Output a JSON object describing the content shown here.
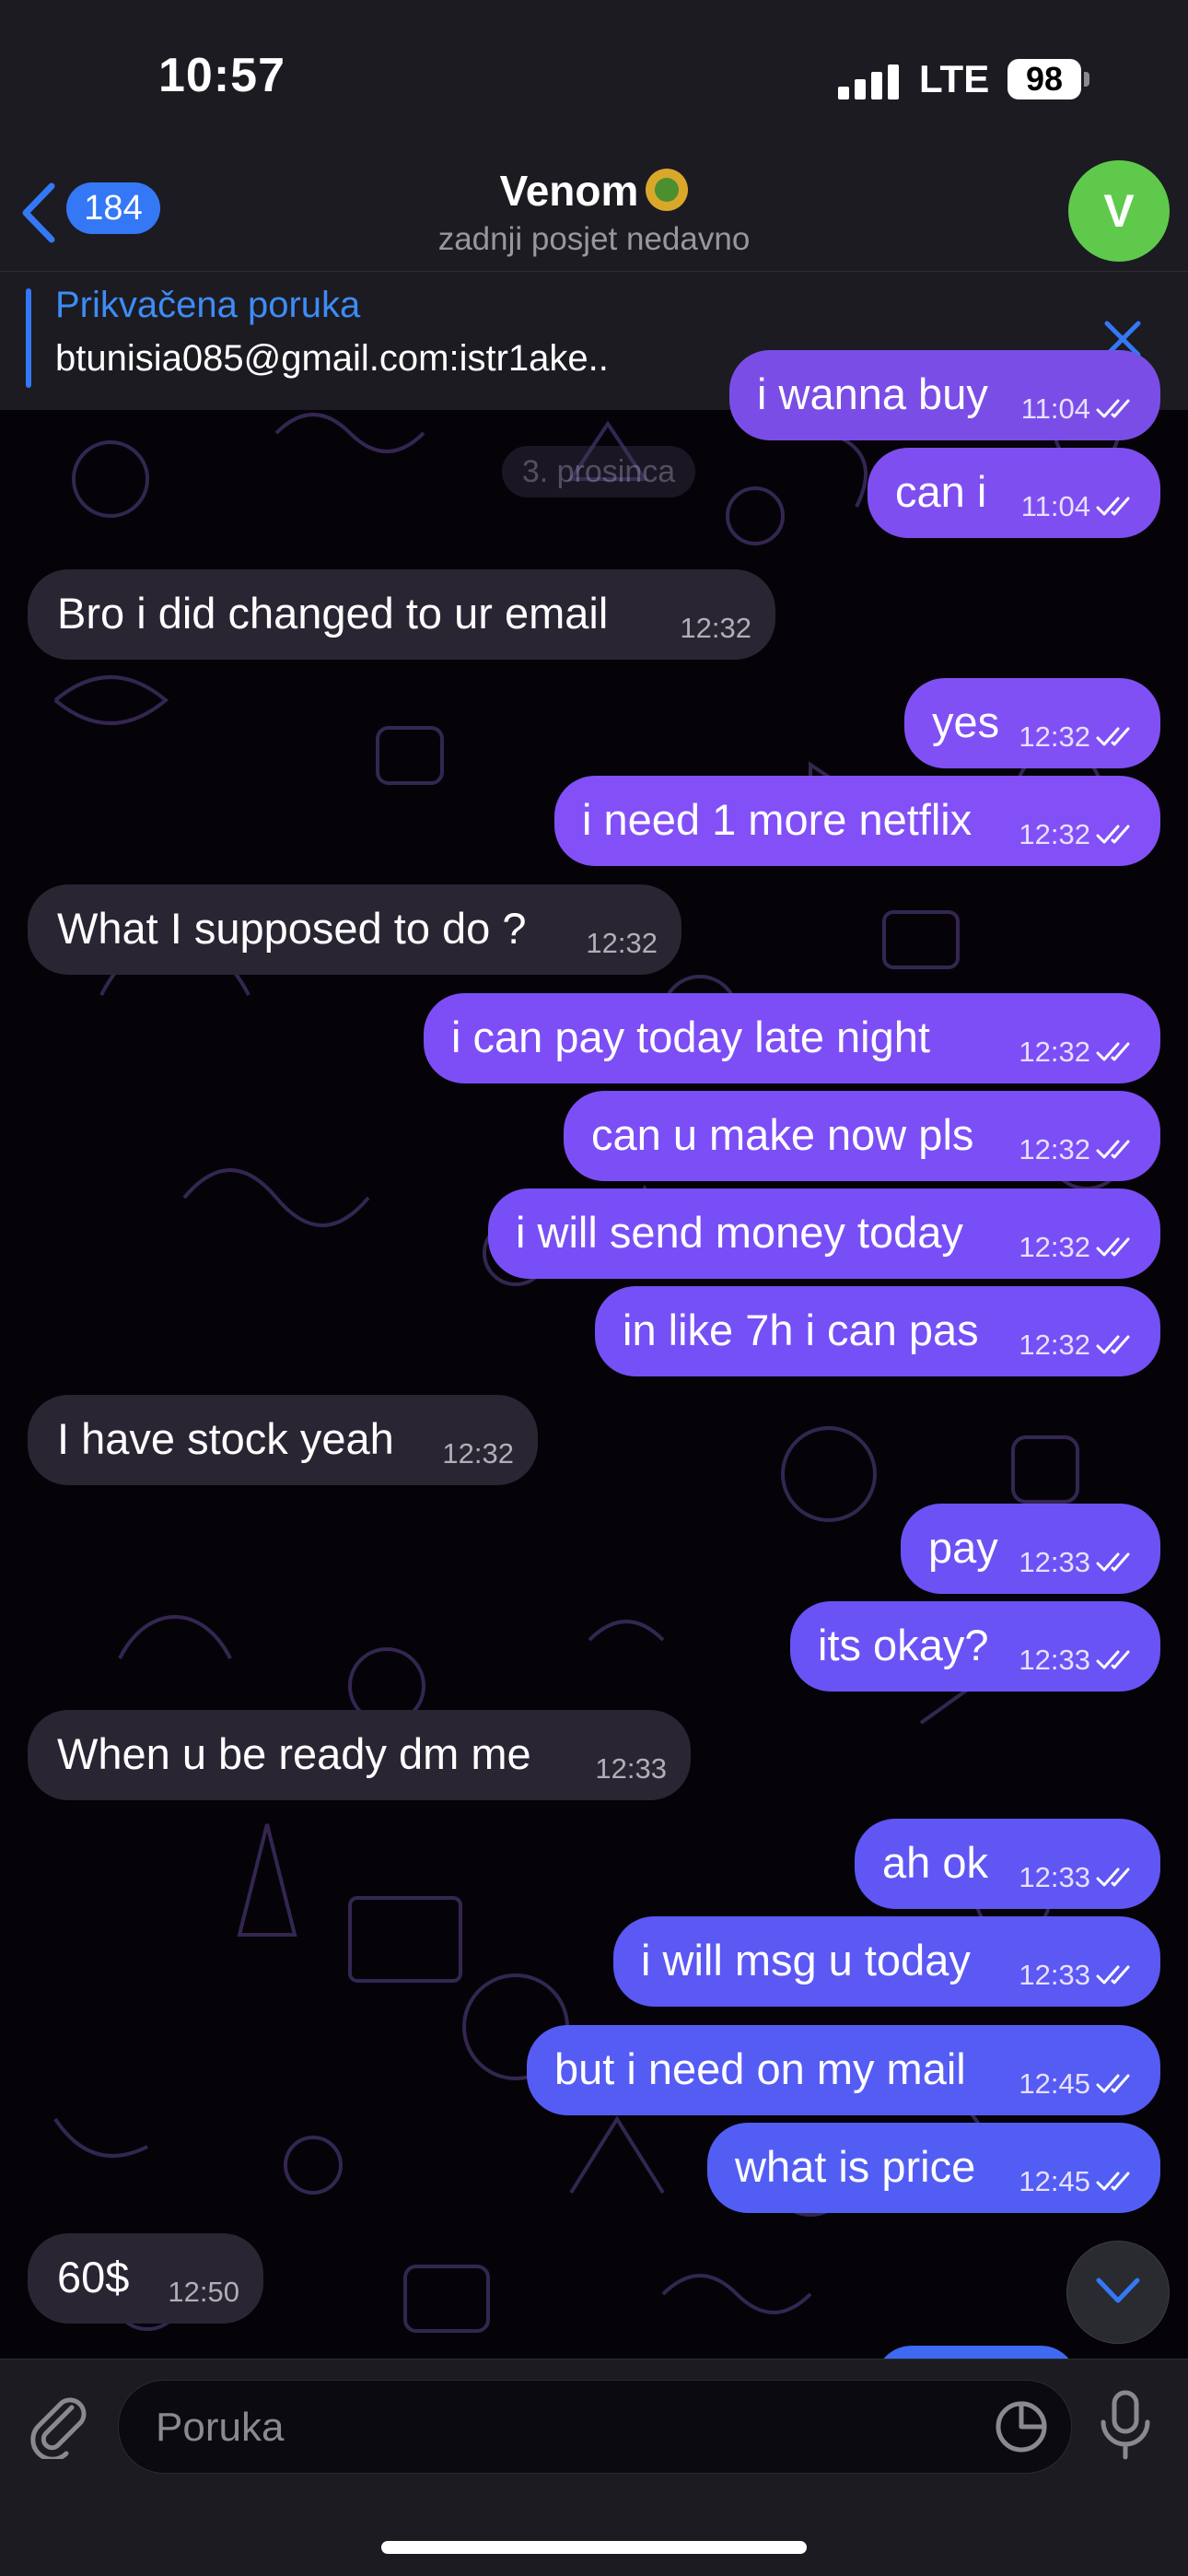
{
  "status_bar": {
    "time": "10:57",
    "network": "LTE",
    "battery": "98"
  },
  "header": {
    "back_count": "184",
    "contact_name": "Venom",
    "status": "zadnji posjet nedavno",
    "avatar_letter": "V"
  },
  "pinned": {
    "title": "Prikvačena poruka",
    "text": "btunisia085@gmail.com:istr1ake.."
  },
  "date_separator": "3. prosinca",
  "messages": [
    {
      "dir": "out",
      "text": "i wanna buy",
      "time": "11:04",
      "color": "#7a4ee6"
    },
    {
      "dir": "out",
      "text": "can i",
      "time": "11:04",
      "color": "#7f4ef0"
    },
    {
      "dir": "in",
      "text": "Bro i did changed to ur email",
      "time": "12:32"
    },
    {
      "dir": "out",
      "text": "yes",
      "time": "12:32",
      "color": "#8150f5"
    },
    {
      "dir": "out",
      "text": "i need 1 more netflix",
      "time": "12:32",
      "color": "#8250f6"
    },
    {
      "dir": "in",
      "text": "What I supposed to do ?",
      "time": "12:32"
    },
    {
      "dir": "out",
      "text": "i can pay today late night",
      "time": "12:32",
      "color": "#7d4ef6"
    },
    {
      "dir": "out",
      "text": "can u make now pls",
      "time": "12:32",
      "color": "#7b4ef6"
    },
    {
      "dir": "out",
      "text": "i will send money today",
      "time": "12:32",
      "color": "#784ff6"
    },
    {
      "dir": "out",
      "text": "in like 7h i can pas",
      "time": "12:32",
      "color": "#7450f6"
    },
    {
      "dir": "in",
      "text": "I have stock yeah",
      "time": "12:32"
    },
    {
      "dir": "out",
      "text": "pay",
      "time": "12:33",
      "color": "#6c52f5"
    },
    {
      "dir": "out",
      "text": "its okay?",
      "time": "12:33",
      "color": "#6953f5"
    },
    {
      "dir": "in",
      "text": "When u be ready dm me",
      "time": "12:33"
    },
    {
      "dir": "out",
      "text": "ah ok",
      "time": "12:33",
      "color": "#5f56f4"
    },
    {
      "dir": "out",
      "text": "i will msg u today",
      "time": "12:33",
      "color": "#5b58f4"
    },
    {
      "dir": "out",
      "text": "but i need on my mail",
      "time": "12:45",
      "color": "#555cf3"
    },
    {
      "dir": "out",
      "text": "what is price",
      "time": "12:45",
      "color": "#525ef3"
    },
    {
      "dir": "in",
      "text": "60$",
      "time": "12:50"
    }
  ],
  "composer": {
    "placeholder": "Poruka"
  },
  "icons": {
    "back": "chevron-left-icon",
    "close": "close-icon",
    "attach": "paperclip-icon",
    "sticker": "sticker-icon",
    "mic": "microphone-icon",
    "scroll_down": "chevron-down-icon"
  },
  "colors": {
    "accent": "#3478f6",
    "incoming_bubble": "#2a2533",
    "avatar": "#5fc94c"
  }
}
